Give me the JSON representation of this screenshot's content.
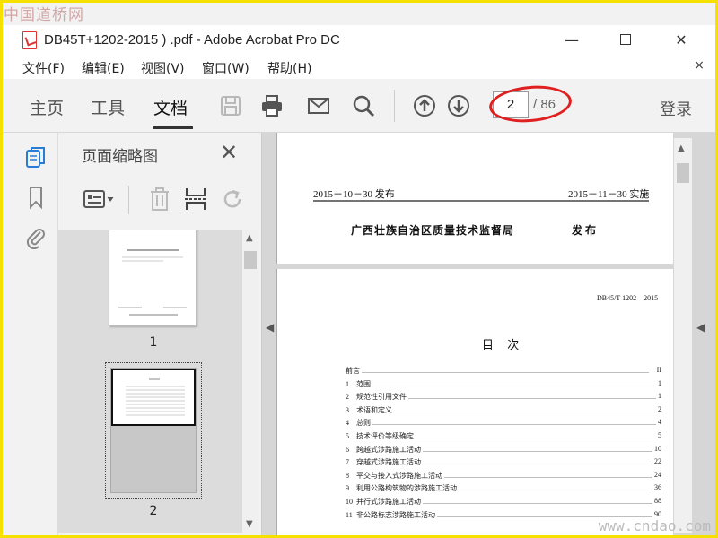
{
  "watermark": {
    "top_left": "中国道桥网",
    "bottom_right": "www.cndao.com"
  },
  "window": {
    "title": "DB45T+1202-2015 ) .pdf - Adobe Acrobat Pro DC",
    "minimize_label": "—",
    "close_label": "✕"
  },
  "menu": {
    "items": [
      "文件(F)",
      "编辑(E)",
      "视图(V)",
      "窗口(W)",
      "帮助(H)"
    ],
    "close_label": "×"
  },
  "toolbar": {
    "tabs": [
      "主页",
      "工具",
      "文档"
    ],
    "active_tab": "文档",
    "current_page": "2",
    "total_pages": "/ 86",
    "login_label": "登录",
    "icons": [
      "save-icon",
      "print-icon",
      "mail-icon",
      "search-icon",
      "page-up-icon",
      "page-down-icon"
    ]
  },
  "left_rail": {
    "icons": [
      "pages-icon",
      "bookmark-icon",
      "attachment-icon"
    ]
  },
  "thumbnail_panel": {
    "title": "页面缩略图",
    "close_label": "✕",
    "thumbnails": [
      {
        "label": "1"
      },
      {
        "label": "2"
      }
    ]
  },
  "document": {
    "page_top": {
      "publish_date": "2015－10－30 发布",
      "implement_date": "2015－11－30 实施",
      "publisher": "广西壮族自治区质量技术监督局",
      "publisher_suffix": "发 布"
    },
    "page_bottom": {
      "code": "DB45/T 1202—2015",
      "toc_title": "目   次",
      "toc": [
        {
          "num": "",
          "text": "前言",
          "page": "II"
        },
        {
          "num": "1",
          "text": "范围",
          "page": "1"
        },
        {
          "num": "2",
          "text": "规范性引用文件",
          "page": "1"
        },
        {
          "num": "3",
          "text": "术语和定义",
          "page": "2"
        },
        {
          "num": "4",
          "text": "总则",
          "page": "4"
        },
        {
          "num": "5",
          "text": "技术评价等级确定",
          "page": "5"
        },
        {
          "num": "6",
          "text": "跨越式涉路施工活动",
          "page": "10"
        },
        {
          "num": "7",
          "text": "穿越式涉路施工活动",
          "page": "22"
        },
        {
          "num": "8",
          "text": "平交与接入式涉路施工活动",
          "page": "24"
        },
        {
          "num": "9",
          "text": "利用公路构筑物的涉路施工活动",
          "page": "36"
        },
        {
          "num": "10",
          "text": "并行式涉路施工活动",
          "page": "88"
        },
        {
          "num": "11",
          "text": "非公路标志涉路施工活动",
          "page": "90"
        }
      ]
    }
  }
}
